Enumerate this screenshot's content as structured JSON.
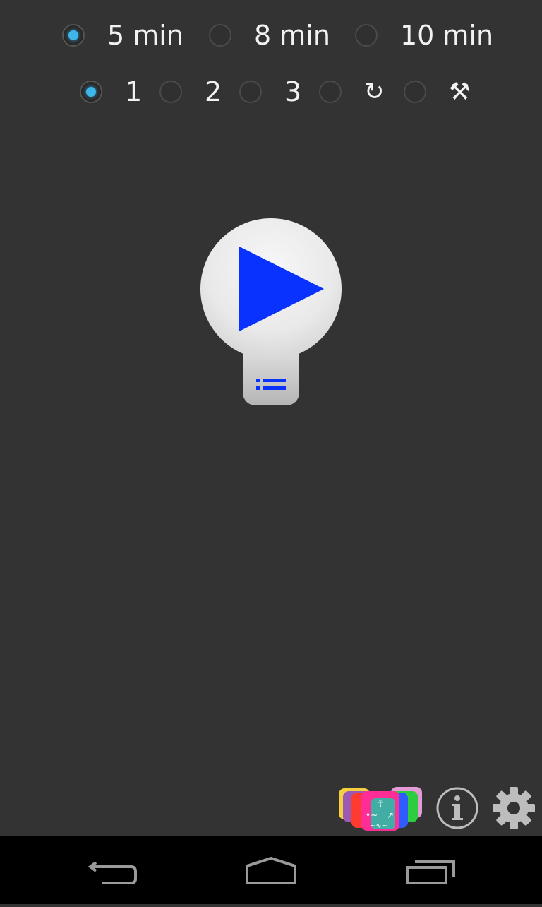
{
  "duration_options": [
    {
      "label": "5 min",
      "checked": true
    },
    {
      "label": "8 min",
      "checked": false
    },
    {
      "label": "10 min",
      "checked": false
    }
  ],
  "mode_options": [
    {
      "label": "1",
      "checked": true
    },
    {
      "label": "2",
      "checked": false
    },
    {
      "label": "3",
      "checked": false
    },
    {
      "label": "↻",
      "checked": false,
      "icon": "repeat-icon"
    },
    {
      "label": "⚒",
      "checked": false,
      "icon": "tools-icon"
    }
  ],
  "colors": {
    "background": "#333333",
    "accent": "#3fb6ea",
    "play_triangle": "#0a32ff",
    "navbar": "#000000"
  },
  "icons": {
    "play": "play-icon",
    "list": "list-icon",
    "apps": "colorful-apps-icon",
    "info": "info-icon",
    "settings": "gear-icon",
    "back": "back-icon",
    "home": "home-icon",
    "recents": "recents-icon"
  }
}
